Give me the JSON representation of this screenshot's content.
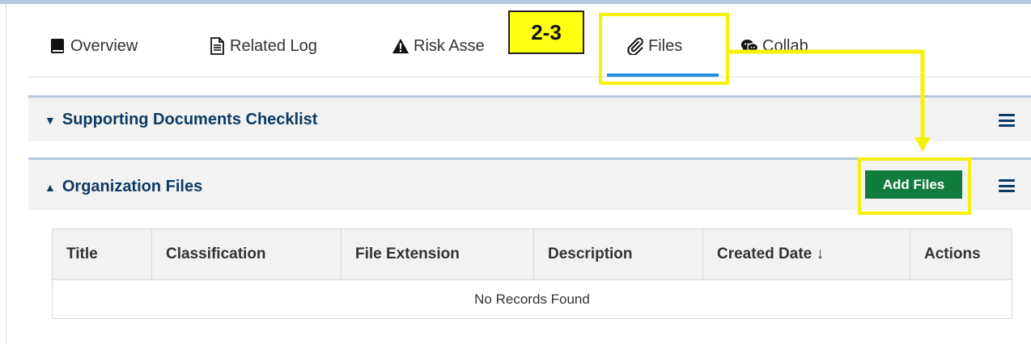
{
  "tabs": [
    {
      "label": "Overview",
      "icon": "book-icon"
    },
    {
      "label": "Related Log",
      "icon": "document-icon"
    },
    {
      "label": "Risk Assessment",
      "visible_label": "Risk Asse",
      "icon": "warning-icon"
    },
    {
      "label": "Files",
      "icon": "paperclip-icon",
      "active": true
    },
    {
      "label": "Collab",
      "icon": "chat-bubbles-icon"
    }
  ],
  "annotation": {
    "step_label": "2-3",
    "highlight_color": "#f5f20a"
  },
  "panels": {
    "supporting_docs": {
      "title": "Supporting Documents Checklist",
      "caret": "▼"
    },
    "org_files": {
      "title": "Organization Files",
      "caret": "▲",
      "add_button": "Add Files"
    }
  },
  "table": {
    "columns": [
      "Title",
      "Classification",
      "File Extension",
      "Description",
      "Created Date ↓",
      "Actions"
    ],
    "empty_message": "No Records Found"
  },
  "colors": {
    "accent_blue": "#1f8fe0",
    "panel_title": "#0d3a63",
    "add_button": "#127c3d",
    "panel_border": "#b6c8df"
  }
}
